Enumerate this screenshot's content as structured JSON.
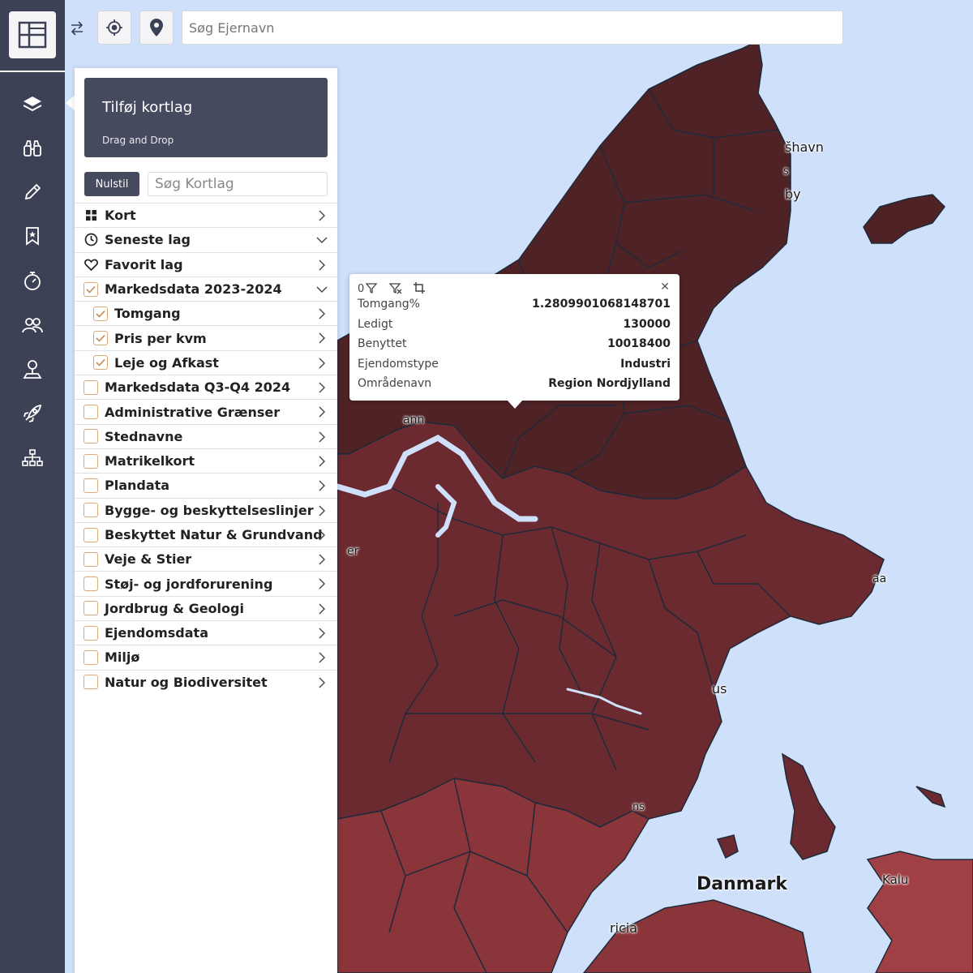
{
  "header": {
    "owner_search_placeholder": "Søg Ejernavn"
  },
  "sidebar": {
    "icons": [
      "layers-icon",
      "binoculars-icon",
      "pencil-icon",
      "bookmark-icon",
      "stopwatch-icon",
      "users-icon",
      "user-location-icon",
      "rocket-icon",
      "sitemap-icon"
    ]
  },
  "panel": {
    "add_title": "Tilføj kortlag",
    "add_subtitle": "Drag and Drop",
    "reset_label": "Nulstil",
    "layer_search_placeholder": "Søg Kortlag",
    "layers": [
      {
        "label": "Kort",
        "lead": "grid-icon",
        "chevron": "right"
      },
      {
        "label": "Seneste lag",
        "lead": "clock-icon",
        "chevron": "down"
      },
      {
        "label": "Favorit lag",
        "lead": "heart-icon",
        "chevron": "right"
      },
      {
        "label": "Markedsdata 2023-2024",
        "lead": "checkbox",
        "checked": true,
        "chevron": "down"
      },
      {
        "label": "Tomgang",
        "lead": "checkbox",
        "checked": true,
        "chevron": "right",
        "sub": true
      },
      {
        "label": "Pris per kvm",
        "lead": "checkbox",
        "checked": true,
        "chevron": "right",
        "sub": true
      },
      {
        "label": "Leje og Afkast",
        "lead": "checkbox",
        "checked": true,
        "chevron": "right",
        "sub": true
      },
      {
        "label": "Markedsdata Q3-Q4 2024",
        "lead": "checkbox",
        "checked": false,
        "chevron": "right"
      },
      {
        "label": "Administrative Grænser",
        "lead": "checkbox",
        "checked": false,
        "chevron": "right"
      },
      {
        "label": "Stednavne",
        "lead": "checkbox",
        "checked": false,
        "chevron": "right"
      },
      {
        "label": "Matrikelkort",
        "lead": "checkbox",
        "checked": false,
        "chevron": "right"
      },
      {
        "label": "Plandata",
        "lead": "checkbox",
        "checked": false,
        "chevron": "right"
      },
      {
        "label": "Bygge- og beskyttelseslinjer",
        "lead": "checkbox",
        "checked": false,
        "chevron": "right"
      },
      {
        "label": "Beskyttet Natur & Grundvand",
        "lead": "checkbox",
        "checked": false,
        "chevron": "right"
      },
      {
        "label": "Veje & Stier",
        "lead": "checkbox",
        "checked": false,
        "chevron": "right"
      },
      {
        "label": "Støj- og jordforurening",
        "lead": "checkbox",
        "checked": false,
        "chevron": "right"
      },
      {
        "label": "Jordbrug & Geologi",
        "lead": "checkbox",
        "checked": false,
        "chevron": "right"
      },
      {
        "label": "Ejendomsdata",
        "lead": "checkbox",
        "checked": false,
        "chevron": "right"
      },
      {
        "label": "Miljø",
        "lead": "checkbox",
        "checked": false,
        "chevron": "right"
      },
      {
        "label": "Natur og Biodiversitet",
        "lead": "checkbox",
        "checked": false,
        "chevron": "right"
      }
    ]
  },
  "popup": {
    "rows": [
      {
        "key": "Tomgang%",
        "value": "1.2809901068148701"
      },
      {
        "key": "Ledigt",
        "value": "130000"
      },
      {
        "key": "Benyttet",
        "value": "10018400"
      },
      {
        "key": "Ejendomstype",
        "value": "Industri"
      },
      {
        "key": "Områdenavn",
        "value": "Region Nordjylland"
      }
    ]
  },
  "map": {
    "labels": {
      "frederikshavn": "šhavn",
      "s_fragment": "s",
      "by_fragment": "by",
      "ann_fragment": "ann",
      "er_fragment": "er",
      "aa_fragment": "aa",
      "aarhus_fragment": "us",
      "denmark": "Danmark",
      "kalu": "Kalu",
      "ricia": "ricia",
      "ns_fragment": "ns"
    },
    "colors": {
      "sea": "#cfe0fb",
      "north_region": "#4f2226",
      "mid_region": "#6a2a2f",
      "south_region": "#8a3539",
      "zealand": "#a03f44",
      "border": "#1e2a3a"
    }
  }
}
